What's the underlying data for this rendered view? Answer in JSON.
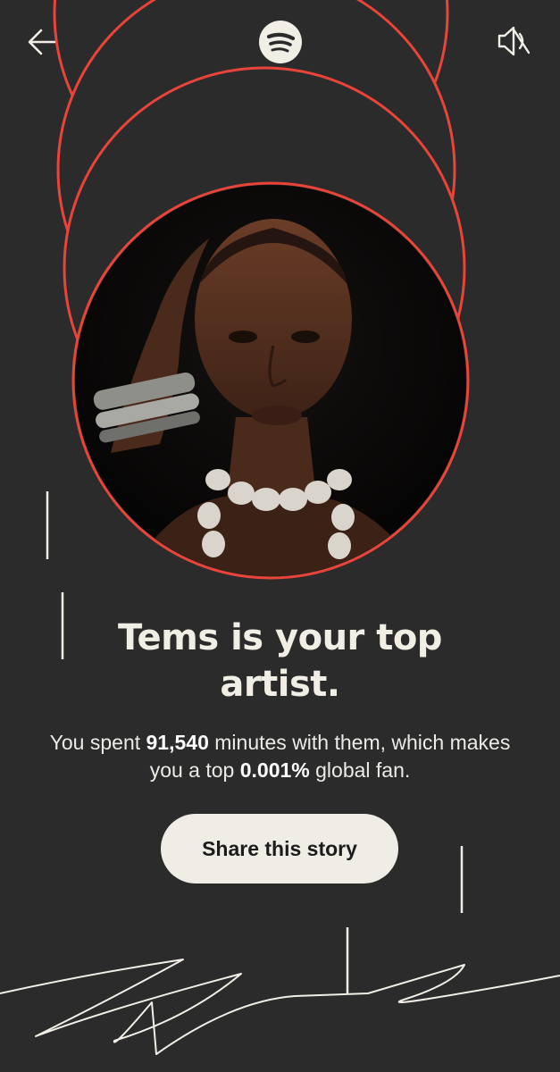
{
  "navigation": {
    "back_icon": "arrow-left-icon",
    "logo_icon": "spotify-logo-icon",
    "sound_icon": "speaker-muted-icon"
  },
  "story": {
    "headline_line1": "Tems is your top",
    "headline_line2": "artist.",
    "subtitle_part1": "You spent ",
    "minutes": "91,540",
    "subtitle_part2": " minutes with them, which makes you a top ",
    "percentile": "0.001%",
    "subtitle_part3": " global fan.",
    "share_label": "Share this story"
  },
  "colors": {
    "background": "#2b2b2b",
    "ring": "#e8443a",
    "text": "#f1eee6",
    "button": "#efede6"
  }
}
